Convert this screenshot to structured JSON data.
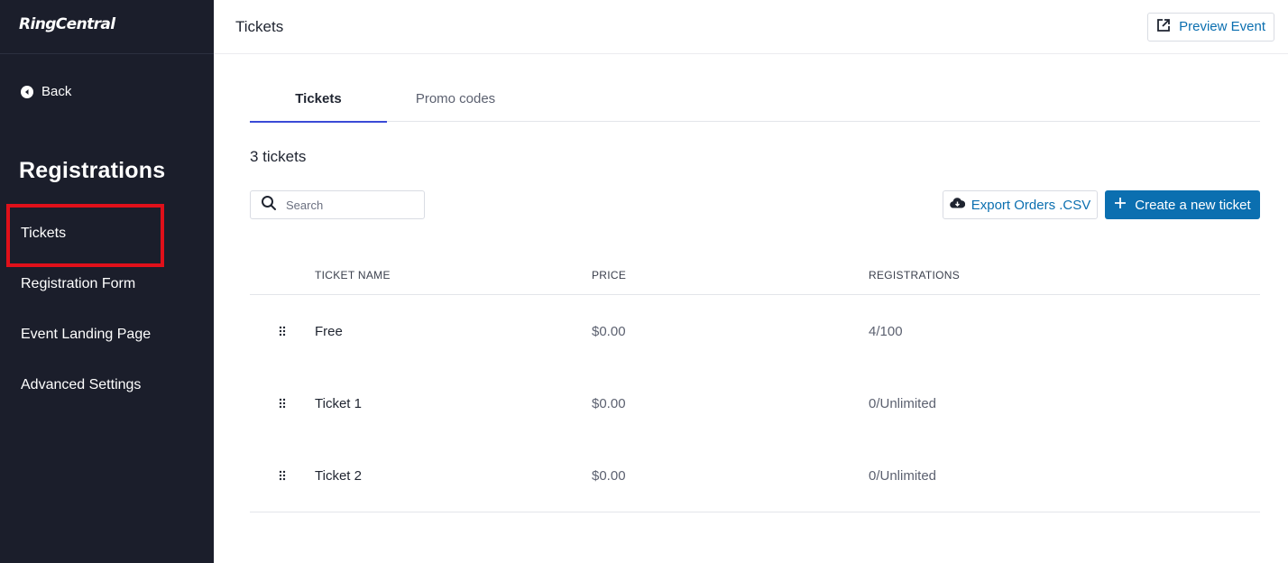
{
  "sidebar": {
    "logo": "RingCentral",
    "back_label": "Back",
    "section_title": "Registrations",
    "items": [
      {
        "label": "Tickets"
      },
      {
        "label": "Registration Form"
      },
      {
        "label": "Event Landing Page"
      },
      {
        "label": "Advanced Settings"
      }
    ]
  },
  "header": {
    "title": "Tickets",
    "preview_label": "Preview Event"
  },
  "tabs": [
    {
      "label": "Tickets",
      "active": true
    },
    {
      "label": "Promo codes",
      "active": false
    }
  ],
  "tickets_count": "3 tickets",
  "search": {
    "placeholder": "Search",
    "value": ""
  },
  "actions": {
    "export_label": "Export Orders .CSV",
    "create_label": "Create a new ticket"
  },
  "table": {
    "headers": [
      "TICKET NAME",
      "PRICE",
      "REGISTRATIONS"
    ],
    "rows": [
      {
        "name": "Free",
        "price": "$0.00",
        "registrations": "4/100"
      },
      {
        "name": "Ticket 1",
        "price": "$0.00",
        "registrations": "0/Unlimited"
      },
      {
        "name": "Ticket 2",
        "price": "$0.00",
        "registrations": "0/Unlimited"
      }
    ]
  },
  "colors": {
    "sidebar_bg": "#1b1e2b",
    "accent_blue": "#0b6fb0",
    "tab_indicator": "#3a4ad6",
    "highlight_red": "#e0101a"
  }
}
